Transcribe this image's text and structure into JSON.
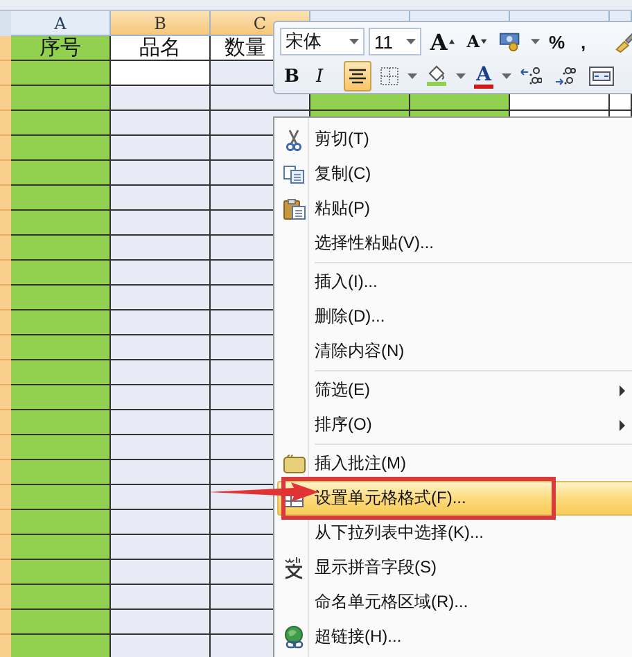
{
  "sheet": {
    "columns": [
      {
        "letter": "A",
        "color": "#92d050",
        "selected": false
      },
      {
        "letter": "B",
        "selected": true,
        "active_cell": true
      },
      {
        "letter": "C",
        "selected": true
      },
      {
        "color": "#92d050",
        "selected": false
      },
      {
        "color": "#92d050",
        "selected": false
      },
      {
        "selected": false
      }
    ],
    "header_row": [
      "序号",
      "品名",
      "数量"
    ]
  },
  "mini_toolbar": {
    "font": "宋体",
    "size": "11",
    "rows": [
      [
        {
          "kind": "grow-font",
          "label": "A",
          "selected": false
        },
        {
          "kind": "shrink-font",
          "label": "A",
          "selected": false
        },
        {
          "kind": "accounting",
          "selected": false,
          "dropdown": true
        },
        {
          "kind": "percent",
          "label": "%",
          "selected": false
        },
        {
          "kind": "comma",
          "label": ",",
          "selected": false
        },
        {
          "kind": "painter",
          "selected": false
        }
      ],
      [
        {
          "kind": "bold",
          "label": "B",
          "selected": false
        },
        {
          "kind": "italic",
          "label": "I",
          "selected": false
        },
        {
          "kind": "center",
          "selected": true
        },
        {
          "kind": "borders",
          "selected": false,
          "dropdown": true
        },
        {
          "kind": "fill",
          "selected": false,
          "dropdown": true
        },
        {
          "kind": "font-color",
          "label": "A",
          "selected": false,
          "dropdown": true
        },
        {
          "kind": "inc-decimal",
          "selected": false
        },
        {
          "kind": "dec-decimal",
          "selected": false
        },
        {
          "kind": "merge",
          "selected": false
        }
      ]
    ]
  },
  "context_menu": {
    "groups": [
      [
        {
          "kind": "cut",
          "label": "剪切(T)",
          "submenu": false,
          "selected": false
        },
        {
          "kind": "copy",
          "label": "复制(C)",
          "submenu": false,
          "selected": false
        },
        {
          "kind": "paste",
          "label": "粘贴(P)",
          "submenu": false,
          "selected": false
        },
        {
          "kind": "plain",
          "label": "选择性粘贴(V)...",
          "submenu": false,
          "selected": false
        }
      ],
      [
        {
          "kind": "plain",
          "label": "插入(I)...",
          "submenu": false,
          "selected": false
        },
        {
          "kind": "plain",
          "label": "删除(D)...",
          "submenu": false,
          "selected": false
        },
        {
          "kind": "plain",
          "label": "清除内容(N)",
          "submenu": false,
          "selected": false
        }
      ],
      [
        {
          "kind": "plain",
          "label": "筛选(E)",
          "submenu": true,
          "selected": false
        },
        {
          "kind": "plain",
          "label": "排序(O)",
          "submenu": true,
          "selected": false
        }
      ],
      [
        {
          "kind": "comment",
          "label": "插入批注(M)",
          "submenu": false,
          "selected": false
        },
        {
          "kind": "format",
          "label": "设置单元格格式(F)...",
          "submenu": false,
          "selected": true
        },
        {
          "kind": "plain",
          "label": "从下拉列表中选择(K)...",
          "submenu": false,
          "selected": false
        },
        {
          "kind": "phonetic",
          "label": "显示拼音字段(S)",
          "submenu": false,
          "selected": false
        },
        {
          "kind": "plain",
          "label": "命名单元格区域(R)...",
          "submenu": false,
          "selected": false
        },
        {
          "kind": "hyperlink",
          "label": "超链接(H)...",
          "submenu": false,
          "selected": false
        }
      ]
    ]
  }
}
